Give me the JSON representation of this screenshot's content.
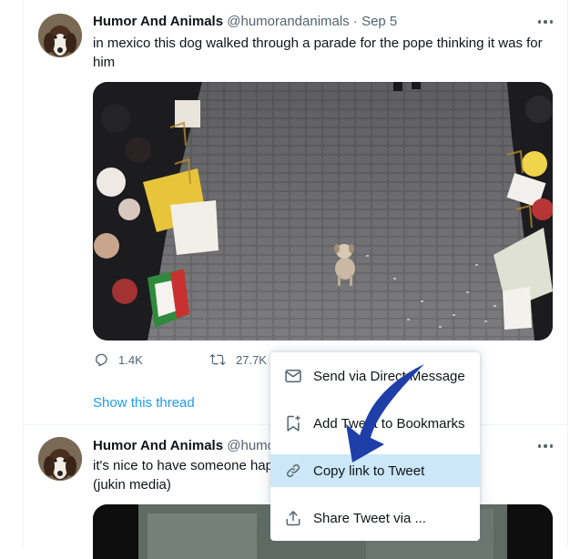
{
  "tweet1": {
    "author_name": "Humor And Animals",
    "handle": "@humorandanimals",
    "separator": "·",
    "date": "Sep 5",
    "text_line1": "in mexico this dog walked through a parade for the pope thinking it was for",
    "text_line2": "him",
    "actions": {
      "reply_count": "1.4K",
      "retweet_count": "27.7K"
    },
    "show_thread": "Show this thread"
  },
  "tweet2": {
    "author_name": "Humor And Animals",
    "handle_partial": "@humo",
    "text_line1": "it's nice to have someone hap",
    "text_line2": "(jukin media)"
  },
  "share_menu": {
    "items": [
      {
        "label": "Send via Direct Message",
        "icon": "envelope-icon"
      },
      {
        "label": "Add Tweet to Bookmarks",
        "icon": "bookmark-add-icon"
      },
      {
        "label": "Copy link to Tweet",
        "icon": "link-icon"
      },
      {
        "label": "Share Tweet via ...",
        "icon": "share-icon"
      }
    ]
  },
  "colors": {
    "accent": "#1d9bf0",
    "menu_highlight": "#cce7f8",
    "annotation_arrow": "#1f3fa8"
  }
}
